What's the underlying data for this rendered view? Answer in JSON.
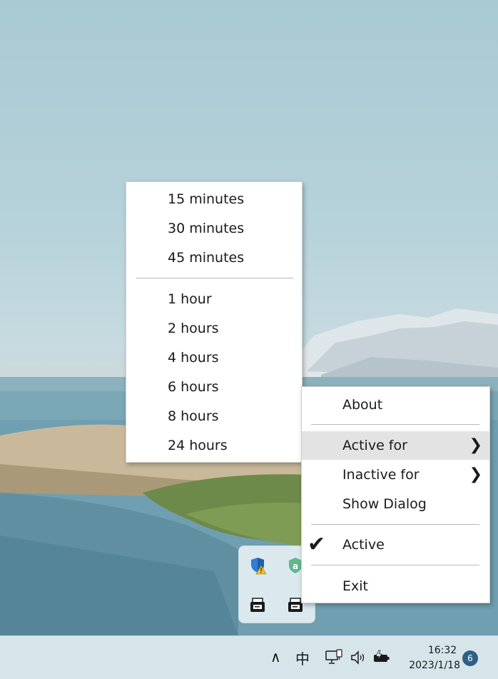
{
  "submenu": {
    "items_top": [
      "15 minutes",
      "30 minutes",
      "45 minutes"
    ],
    "items_bottom": [
      "1 hour",
      "2 hours",
      "4 hours",
      "6 hours",
      "8 hours",
      "24 hours"
    ]
  },
  "tray_menu": {
    "about": "About",
    "active_for": "Active for",
    "inactive_for": "Inactive for",
    "show_dialog": "Show Dialog",
    "active": "Active",
    "active_checked": true,
    "exit": "Exit",
    "chevron_glyph": "❯",
    "check_glyph": "✔"
  },
  "taskbar": {
    "chevron_up": "∧",
    "ime": "中",
    "time": "16:32",
    "date": "2023/1/18",
    "notification_count": "6"
  },
  "colors": {
    "menu_highlight": "#e3e3e3",
    "badge": "#2f5f86",
    "taskbar": "#d6e5ea"
  }
}
